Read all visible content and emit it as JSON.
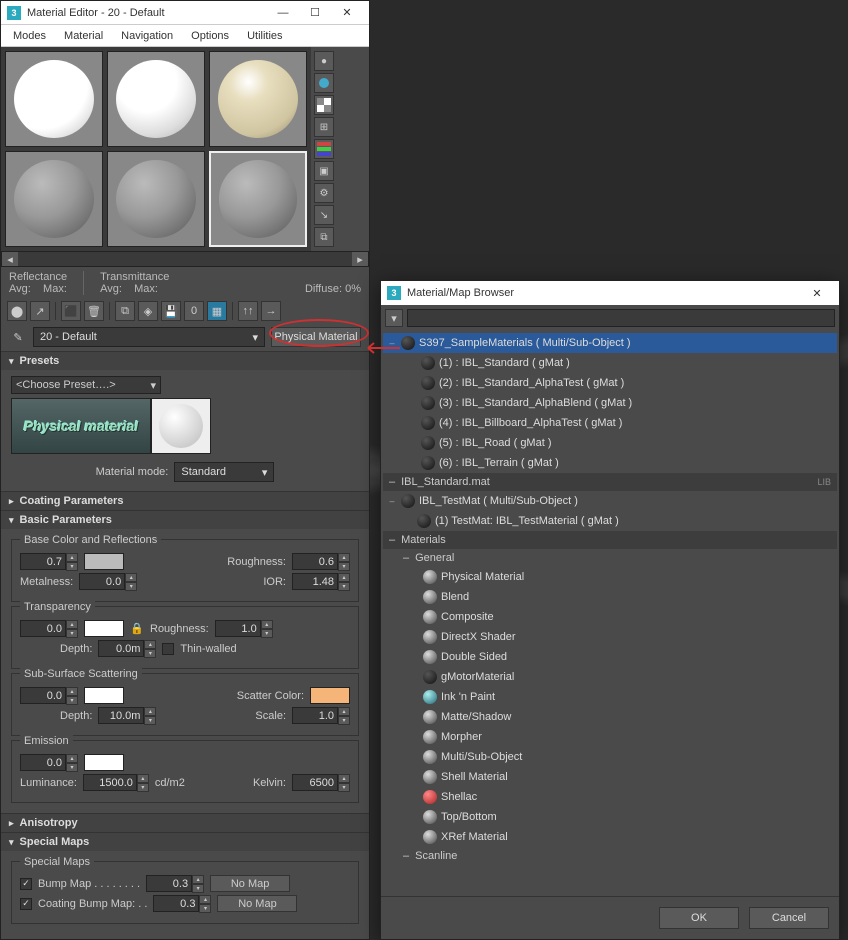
{
  "material_editor": {
    "title": "Material Editor - 20 - Default",
    "menu": [
      "Modes",
      "Material",
      "Navigation",
      "Options",
      "Utilities"
    ],
    "stats": {
      "reflectance": "Reflectance",
      "refl_avg": "Avg:",
      "refl_max": "Max:",
      "transmittance": "Transmittance",
      "trans_avg": "Avg:",
      "trans_max": "Max:",
      "diffuse_lbl": "Diffuse:",
      "diffuse_val": "0%"
    },
    "material_name": "20 - Default",
    "material_type": "Physical Material",
    "rollouts": {
      "presets": {
        "title": "Presets",
        "choose": "<Choose Preset….>",
        "logo_text": "Physical material",
        "mode_lbl": "Material mode:",
        "mode_val": "Standard"
      },
      "coating": "Coating Parameters",
      "basic": {
        "title": "Basic Parameters",
        "base_color_grp": "Base Color and Reflections",
        "weight": "0.7",
        "roughness_lbl": "Roughness:",
        "roughness": "0.6",
        "metalness_lbl": "Metalness:",
        "metalness": "0.0",
        "ior_lbl": "IOR:",
        "ior": "1.48",
        "transparency_grp": "Transparency",
        "trans_weight": "0.0",
        "trans_rough_lbl": "Roughness:",
        "trans_rough": "1.0",
        "depth_lbl": "Depth:",
        "depth": "0.0m",
        "thin_walled": "Thin-walled",
        "sss_grp": "Sub-Surface Scattering",
        "sss_weight": "0.0",
        "scatter_color_lbl": "Scatter Color:",
        "sss_depth_lbl": "Depth:",
        "sss_depth": "10.0m",
        "scale_lbl": "Scale:",
        "scale": "1.0",
        "emission_grp": "Emission",
        "emit_weight": "0.0",
        "luminance_lbl": "Luminance:",
        "luminance": "1500.0",
        "luminance_unit": "cd/m2",
        "kelvin_lbl": "Kelvin:",
        "kelvin": "6500"
      },
      "anisotropy": "Anisotropy",
      "special_maps": {
        "title": "Special Maps",
        "grp": "Special Maps",
        "bump_lbl": "Bump Map . . . . . . . .",
        "bump_val": "0.3",
        "coat_bump_lbl": "Coating Bump Map: . .",
        "coat_bump_val": "0.3",
        "nomap": "No Map"
      }
    }
  },
  "browser": {
    "title": "Material/Map Browser",
    "scene_root": "S397_SampleMaterials  ( Multi/Sub-Object )",
    "scene_children": [
      "(1) : IBL_Standard  ( gMat )",
      "(2) : IBL_Standard_AlphaTest  ( gMat )",
      "(3) : IBL_Standard_AlphaBlend  ( gMat )",
      "(4) : IBL_Billboard_AlphaTest  ( gMat )",
      "(5) : IBL_Road  ( gMat )",
      "(6) : IBL_Terrain  ( gMat )"
    ],
    "lib_header": "IBL_Standard.mat",
    "lib_tag": "LIB",
    "lib_root": "IBL_TestMat  ( Multi/Sub-Object )",
    "lib_child": "(1) TestMat: IBL_TestMaterial ( gMat )",
    "materials_header": "Materials",
    "general_header": "General",
    "general_items": [
      {
        "label": "Physical Material",
        "ball": ""
      },
      {
        "label": "Blend",
        "ball": ""
      },
      {
        "label": "Composite",
        "ball": ""
      },
      {
        "label": "DirectX Shader",
        "ball": ""
      },
      {
        "label": "Double Sided",
        "ball": ""
      },
      {
        "label": "gMotorMaterial",
        "ball": "dark"
      },
      {
        "label": "Ink 'n Paint",
        "ball": "blue"
      },
      {
        "label": "Matte/Shadow",
        "ball": ""
      },
      {
        "label": "Morpher",
        "ball": ""
      },
      {
        "label": "Multi/Sub-Object",
        "ball": ""
      },
      {
        "label": "Shell Material",
        "ball": ""
      },
      {
        "label": "Shellac",
        "ball": "red"
      },
      {
        "label": "Top/Bottom",
        "ball": ""
      },
      {
        "label": "XRef Material",
        "ball": ""
      }
    ],
    "scanline_header": "Scanline",
    "ok": "OK",
    "cancel": "Cancel"
  }
}
